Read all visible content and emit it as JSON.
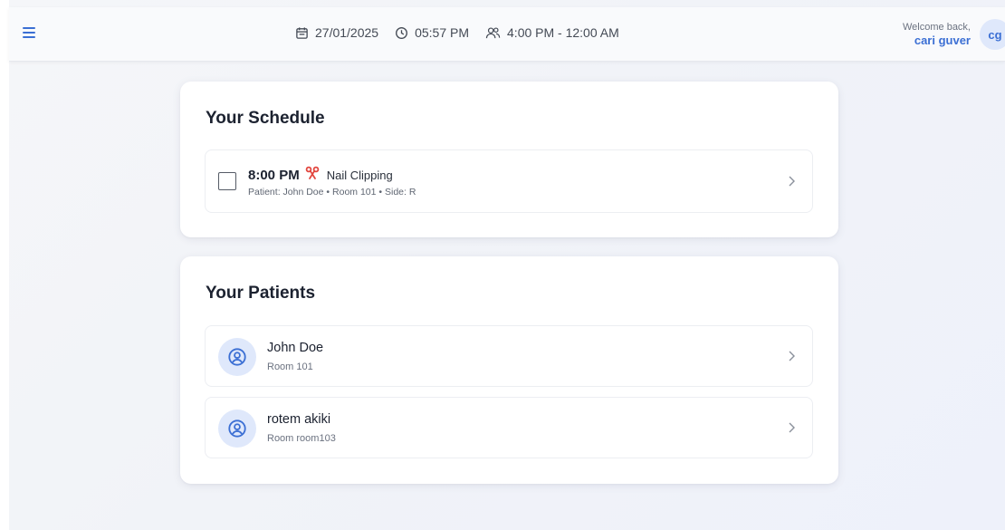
{
  "header": {
    "menu_icon": "hamburger-menu-icon",
    "date": "27/01/2025",
    "time": "05:57 PM",
    "shift": "4:00 PM - 12:00 AM",
    "welcome_label": "Welcome back,",
    "user_name": "cari guver",
    "user_initials": "cg"
  },
  "schedule": {
    "title": "Your Schedule",
    "items": [
      {
        "time": "8:00 PM",
        "task": "Nail Clipping",
        "task_icon": "scissors-icon",
        "patient_label": "Patient: John Doe",
        "room_label": "Room 101",
        "side_label": "Side: R",
        "separator": "•",
        "checked": false
      }
    ]
  },
  "patients": {
    "title": "Your Patients",
    "items": [
      {
        "name": "John Doe",
        "room": "Room 101"
      },
      {
        "name": "rotem akiki",
        "room": "Room room103"
      }
    ]
  },
  "colors": {
    "accent": "#3b6fd4",
    "avatar_bg": "#dfe8fb",
    "scissors": "#e2463e",
    "page_bg": "#f3f5f9"
  }
}
